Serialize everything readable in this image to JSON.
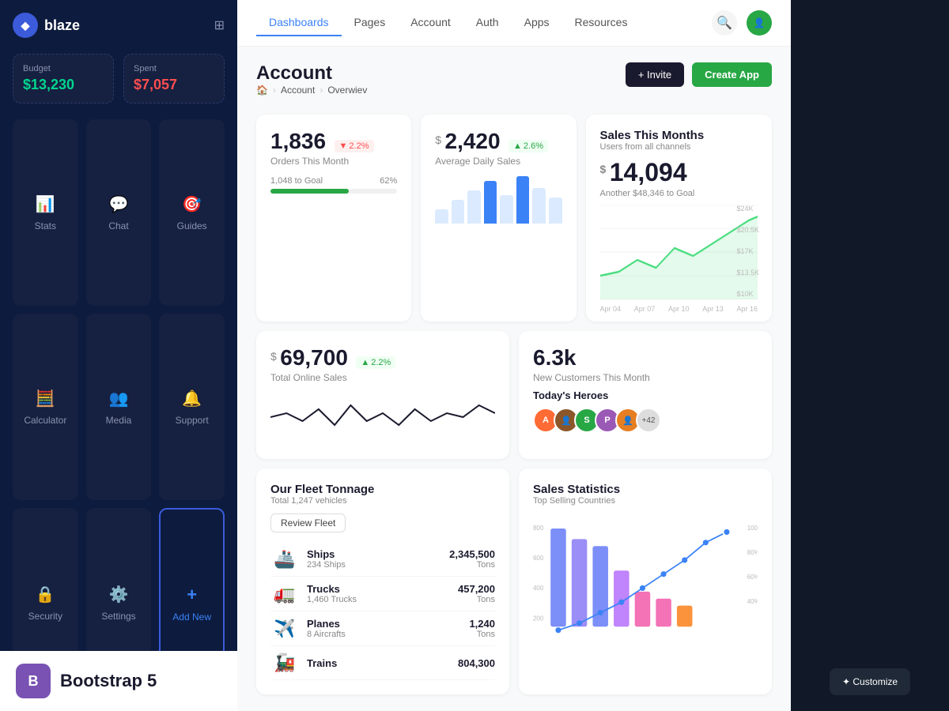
{
  "app": {
    "name": "blaze",
    "logo_symbol": "◆"
  },
  "sidebar": {
    "header_icon": "⊞",
    "budget": {
      "label": "Budget",
      "value": "$13,230",
      "color": "green"
    },
    "spent": {
      "label": "Spent",
      "value": "$7,057",
      "color": "red"
    },
    "nav_items": [
      {
        "id": "stats",
        "label": "Stats",
        "icon": "📊",
        "active": false
      },
      {
        "id": "chat",
        "label": "Chat",
        "icon": "💬",
        "active": false
      },
      {
        "id": "guides",
        "label": "Guides",
        "icon": "🎯",
        "active": false
      },
      {
        "id": "calculator",
        "label": "Calculator",
        "icon": "🧮",
        "active": false
      },
      {
        "id": "media",
        "label": "Media",
        "icon": "👥",
        "active": false
      },
      {
        "id": "support",
        "label": "Support",
        "icon": "🔔",
        "active": false
      },
      {
        "id": "security",
        "label": "Security",
        "icon": "🔒",
        "active": false
      },
      {
        "id": "settings",
        "label": "Settings",
        "icon": "⚙️",
        "active": false
      },
      {
        "id": "add-new",
        "label": "Add New",
        "icon": "+",
        "active": true,
        "special": true
      }
    ],
    "bootstrap_label": "Bootstrap 5"
  },
  "topnav": {
    "tabs": [
      {
        "id": "dashboards",
        "label": "Dashboards",
        "active": true
      },
      {
        "id": "pages",
        "label": "Pages",
        "active": false
      },
      {
        "id": "account",
        "label": "Account",
        "active": false
      },
      {
        "id": "auth",
        "label": "Auth",
        "active": false
      },
      {
        "id": "apps",
        "label": "Apps",
        "active": false
      },
      {
        "id": "resources",
        "label": "Resources",
        "active": false
      }
    ]
  },
  "page": {
    "title": "Account",
    "breadcrumb": {
      "home": "🏠",
      "section": "Account",
      "page": "Overwiev"
    },
    "invite_label": "+ Invite",
    "create_app_label": "Create App"
  },
  "stats": {
    "orders": {
      "value": "1,836",
      "label": "Orders This Month",
      "change": "2.2%",
      "change_dir": "down",
      "goal_current": "1,048 to Goal",
      "goal_pct": "62%",
      "goal_fill": 62
    },
    "daily_sales": {
      "currency": "$",
      "value": "2,420",
      "label": "Average Daily Sales",
      "change": "2.6%",
      "change_dir": "up"
    },
    "sales_month": {
      "title": "Sales This Months",
      "subtitle": "Users from all channels",
      "currency": "$",
      "value": "14,094",
      "goal_text": "Another $48,346 to Goal",
      "y_axis": [
        "$24K",
        "$20.5K",
        "$17K",
        "$13.5K",
        "$10K"
      ],
      "x_axis": [
        "Apr 04",
        "Apr 07",
        "Apr 10",
        "Apr 13",
        "Apr 16"
      ]
    },
    "online_sales": {
      "currency": "$",
      "value": "69,700",
      "label": "Total Online Sales",
      "change": "2.2%",
      "change_dir": "up"
    },
    "new_customers": {
      "value": "6.3k",
      "label": "New Customers This Month",
      "heroes_title": "Today's Heroes",
      "hero_count": "+42"
    }
  },
  "fleet": {
    "title": "Our Fleet Tonnage",
    "subtitle": "Total 1,247 vehicles",
    "review_label": "Review Fleet",
    "items": [
      {
        "icon": "🚢",
        "name": "Ships",
        "count": "234 Ships",
        "value": "2,345,500",
        "unit": "Tons"
      },
      {
        "icon": "🚛",
        "name": "Trucks",
        "count": "1,460 Trucks",
        "value": "457,200",
        "unit": "Tons"
      },
      {
        "icon": "✈️",
        "name": "Planes",
        "count": "8 Aircrafts",
        "value": "1,240",
        "unit": "Tons"
      },
      {
        "icon": "🚂",
        "name": "Trains",
        "count": "",
        "value": "804,300",
        "unit": ""
      }
    ]
  },
  "sales_stats": {
    "title": "Sales Statistics",
    "subtitle": "Top Selling Countries"
  },
  "customize": {
    "label": "✦ Customize"
  }
}
